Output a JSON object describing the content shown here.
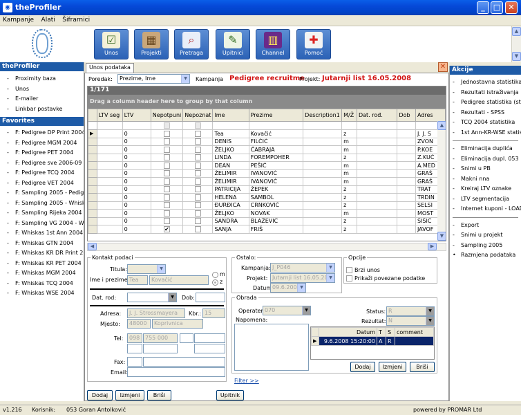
{
  "window": {
    "title": "theProfiler",
    "minimize": "_",
    "maximize": "□",
    "close": "✕"
  },
  "menu": [
    "Kampanje",
    "Alati",
    "Šifrarnici"
  ],
  "toolbar": [
    {
      "label": "Unos",
      "icon": "form-check-icon",
      "glyph": "☑"
    },
    {
      "label": "Projekti",
      "icon": "cubes-icon",
      "glyph": "▦"
    },
    {
      "label": "Pretraga",
      "icon": "magnifier-icon",
      "glyph": "⌕"
    },
    {
      "label": "Upitnici",
      "icon": "questionnaire-icon",
      "glyph": "✎"
    },
    {
      "label": "Channel",
      "icon": "books-icon",
      "glyph": "▥"
    },
    {
      "label": "Pomoć",
      "icon": "lifebuoy-icon",
      "glyph": "✚"
    }
  ],
  "left": {
    "header": "theProfiler",
    "items": [
      "Proximity baza",
      "Unos",
      "E-mailer",
      "Linkbar postavke"
    ],
    "favorites_header": "Favorites",
    "favorites": [
      "F: Pedigree DP Print 2004",
      "F: Pedigree MGM 2004",
      "F: Pedigree PET 2004",
      "F: Pedigree sve 2006-09",
      "F: Pedigree TCQ 2004",
      "F: Pedigree VET 2004",
      "F: Sampling 2005 - Pedigr",
      "F: Sampling 2005 - Whiska",
      "F: Sampling Rijeka 2004 -",
      "F: Sampling VG 2004 - Wh",
      "F: Whiskas 1st Ann 2004",
      "F: Whiskas GTN 2004",
      "F: Whiskas KR DR Print 20",
      "F: Whiskas KR PET 2004",
      "F: Whiskas MGM 2004",
      "F: Whiskas TCQ 2004",
      "F: Whiskas WSE 2004"
    ]
  },
  "right": {
    "header": "Akcije",
    "group1": [
      "Jednostavna statistika",
      "Rezultati istraživanja",
      "Pedigree statistika (sta",
      "Rezultati - SPSS",
      "TCQ 2004 statistika",
      "1st Ann-KR-WSE statis"
    ],
    "group2": [
      "Eliminacija duplića",
      "Eliminacija dupl. 053",
      "Snimi u PB",
      "Makni nna",
      "Kreiraj LTV oznake",
      "LTV segmentacija",
      "Internet kuponi - LOAD"
    ],
    "group3": [
      "Export",
      "Snimi u projekt",
      "Sampling 2005",
      "Razmjena podataka"
    ]
  },
  "tab": {
    "label": "Unos podataka"
  },
  "header": {
    "poredak_label": "Poredak:",
    "poredak_value": "Prezime, Ime",
    "kampanja_label": "Kampanja",
    "kampanja_value": "Pedigree recruitme",
    "projekt_label": "Projekt:",
    "projekt_value": "Jutarnji list 16.05.2008"
  },
  "grid": {
    "count": "1/171",
    "group_hint": "Drag a column header here to group by that column",
    "columns": [
      "LTV seg",
      "LTV",
      "Nepotpuni",
      "Nepoznat",
      "Ime",
      "Prezime",
      "Description1",
      "M/Ž",
      "Dat. rođ.",
      "Dob",
      "Adres"
    ],
    "rows": [
      {
        "ltv": "0",
        "nep": false,
        "ime": "Tea",
        "prezime": "Kovačić",
        "mz": "z",
        "adr": "J. J. S"
      },
      {
        "ltv": "0",
        "nep": false,
        "ime": "DENIS",
        "prezime": "FILČIĆ",
        "mz": "m",
        "adr": "ZVON"
      },
      {
        "ltv": "0",
        "nep": false,
        "ime": "ŽELJKO",
        "prezime": "ĆABRAJA",
        "mz": "m",
        "adr": "P.KOE"
      },
      {
        "ltv": "0",
        "nep": false,
        "ime": "LINDA",
        "prezime": "FOREMPOHER",
        "mz": "z",
        "adr": "Z.KUČ"
      },
      {
        "ltv": "0",
        "nep": false,
        "ime": "DEAN",
        "prezime": "PEŠIĆ",
        "mz": "m",
        "adr": "A.MED"
      },
      {
        "ltv": "0",
        "nep": false,
        "ime": "ŽELIMIR",
        "prezime": "IVANOVIĆ",
        "mz": "m",
        "adr": "GRAŠ"
      },
      {
        "ltv": "0",
        "nep": false,
        "ime": "ŽELIMIR",
        "prezime": "IVANOVIĆ",
        "mz": "m",
        "adr": "GRAŠ"
      },
      {
        "ltv": "0",
        "nep": false,
        "ime": "PATRICIJA",
        "prezime": "ŽEPEK",
        "mz": "z",
        "adr": "TRAT"
      },
      {
        "ltv": "0",
        "nep": false,
        "ime": "HELENA",
        "prezime": "SAMBOL",
        "mz": "z",
        "adr": "TRDIN"
      },
      {
        "ltv": "0",
        "nep": false,
        "ime": "ĐURĐICA",
        "prezime": "CRNKOVIĆ",
        "mz": "z",
        "adr": "SELSI"
      },
      {
        "ltv": "0",
        "nep": false,
        "ime": "ŽELJKO",
        "prezime": "NOVAK",
        "mz": "m",
        "adr": "MOST"
      },
      {
        "ltv": "0",
        "nep": false,
        "ime": "SANDRA",
        "prezime": "BLAŽEVIĆ",
        "mz": "z",
        "adr": "ŠIŠIĆ"
      },
      {
        "ltv": "0",
        "nep": true,
        "ime": "SANJA",
        "prezime": "FRIŠ",
        "mz": "z",
        "adr": "JAVOF"
      }
    ]
  },
  "kontakt": {
    "legend": "Kontakt podaci",
    "titula_label": "Titula:",
    "ime_prezime_label": "Ime i prezime:",
    "ime_value": "Tea",
    "prezime_value": "Kovačić",
    "m_label": "m",
    "z_label": "z",
    "dat_rod_label": "Dat. rod:",
    "dob_label": "Dob:",
    "adresa_label": "Adresa:",
    "adresa_value": "J. J. Strossmayera",
    "kbr_label": "Kbr.:",
    "kbr_value": "15",
    "mjesto_label": "Mjesto:",
    "postanski_value": "48000",
    "mjesto_value": "Koprivnica",
    "tel_label": "Tel:",
    "tel_prefix": "098",
    "tel_value": "755 000",
    "fax_label": "Fax:",
    "email_label": "Email:"
  },
  "ostalo": {
    "legend": "Ostalo:",
    "kampanja_label": "Kampanja:",
    "kampanja_value": "J_P046",
    "projekt_label": "Projekt:",
    "projekt_value": "Jutarnji list 16.05.2008",
    "datum_label": "Datum:",
    "datum_value": "09.6.2008"
  },
  "opcije": {
    "legend": "Opcije",
    "brzi_unos": "Brzi unos",
    "prikazi": "Prikaži povezane podatke"
  },
  "obrada": {
    "legend": "Obrada",
    "operater_label": "Operater:",
    "operater_value": "070",
    "status_label": "Status:",
    "status_value": "R",
    "rezultat_label": "Rezultat:",
    "rezultat_value": "N",
    "napomena_label": "Napomena:",
    "table_headers": [
      "Datum",
      "T",
      "S",
      "comment"
    ],
    "table_row": {
      "datum": "9.6.2008 15:20:00",
      "t": "A",
      "s": "R",
      "comment": ""
    },
    "btn_dodaj": "Dodaj",
    "btn_izmjeni": "Izmjeni",
    "btn_brisi": "Briši"
  },
  "filter_link": "Filter >>",
  "bottom_buttons": {
    "dodaj": "Dodaj",
    "izmjeni": "Izmjeni",
    "brisi": "Briši",
    "upitnik": "Upitnik"
  },
  "status": {
    "version": "v1.216",
    "korisnik_label": "Korisnik:",
    "korisnik_value": "053 Goran Antolković",
    "powered": "powered by PROMAR Ltd"
  }
}
